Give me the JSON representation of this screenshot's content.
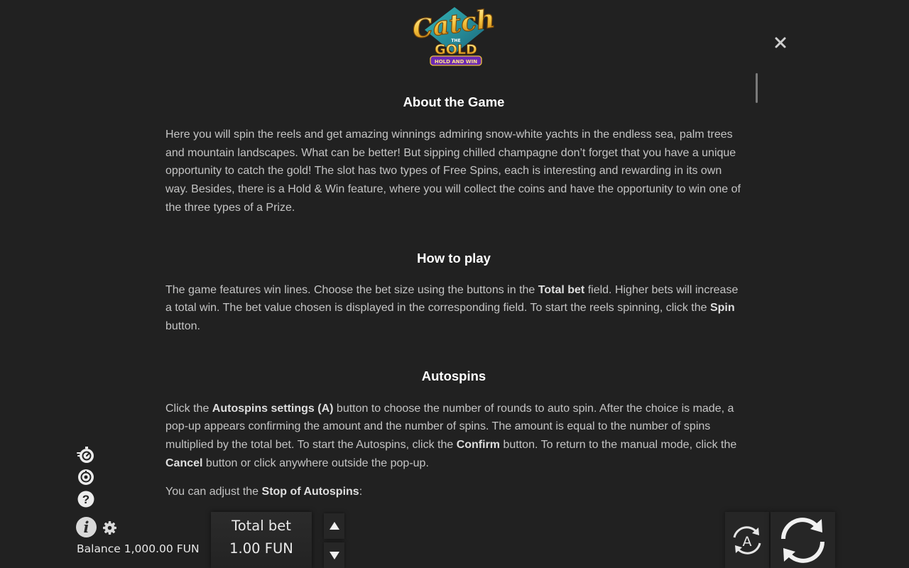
{
  "logo": {
    "line1": "Catch",
    "line2": "THE",
    "line3": "GOLD",
    "line4": "HOLD AND WIN"
  },
  "header": {
    "close_icon": "close-icon"
  },
  "sections": {
    "about": {
      "title": "About the Game",
      "text": "Here you will spin the reels and get amazing winnings admiring snow-white yachts in the endless sea, palm trees and mountain landscapes. What can be better! But sipping chilled champagne don’t forget that you have a unique opportunity to catch the gold! The slot has two types of Free Spins, each is interesting and rewarding in its own way. Besides, there is a Hold & Win feature, where you will collect the coins and have the opportunity to win one of the three types of a Prize."
    },
    "how_to_play": {
      "title": "How to play",
      "t1": "The game features win lines. Choose the bet size using the buttons in the ",
      "b1": "Total bet",
      "t2": " field. Higher bets will increase a total win. The bet value chosen is displayed in the corresponding field. To start the reels spinning, click the ",
      "b2": "Spin",
      "t3": " button."
    },
    "autospins": {
      "title": "Autospins",
      "t1": "Click the ",
      "b1": "Autospins settings (A)",
      "t2": " button to choose the number of rounds to auto spin. After the choice is made, a pop-up appears confirming the amount and the number of spins. The amount is equal to the number of spins multiplied by the total bet. To start the Autospins, click the ",
      "b2": "Confirm",
      "t3": " button. To return to the manual mode, click the ",
      "b3": "Cancel",
      "t4": " button or click anywhere outside the pop-up.",
      "p2_t1": "You can adjust the ",
      "p2_b1": "Stop of Autospins",
      "p2_t2": ":"
    }
  },
  "sidebar": {
    "icons": [
      "turbo-icon",
      "sound-icon",
      "help-icon",
      "info-icon",
      "gear-icon"
    ]
  },
  "footer": {
    "balance": "Balance 1,000.00 FUN",
    "total_bet_label": "Total bet",
    "total_bet_value": "1.00 FUN",
    "autospin_letter": "A"
  },
  "colors": {
    "background": "#212121",
    "heading": "#ffffff",
    "text": "#c4c4c4",
    "logo_gold": "#f2b93b",
    "logo_purple": "#7a3cc4"
  }
}
